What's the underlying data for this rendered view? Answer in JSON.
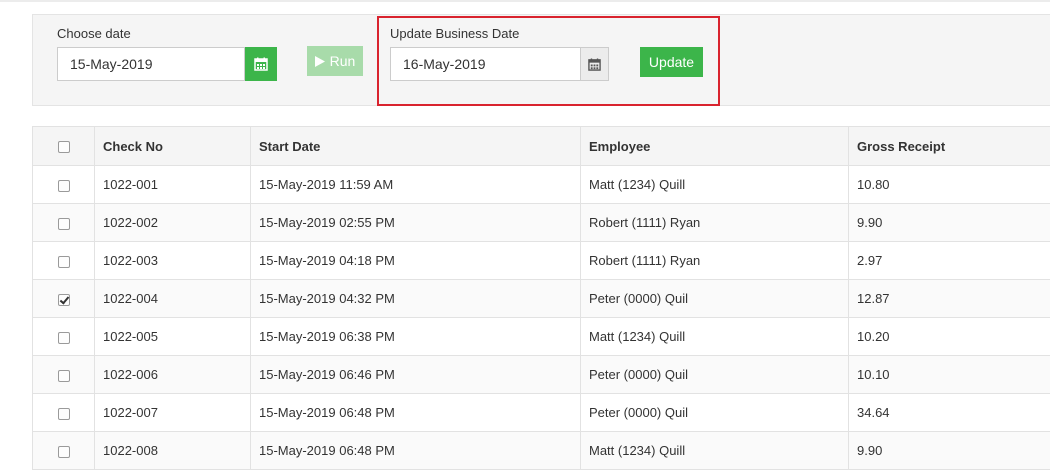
{
  "filter": {
    "choose_date_label": "Choose date",
    "choose_date_value": "15-May-2019",
    "run_label": "Run",
    "update_business_date_label": "Update Business Date",
    "update_date_value": "16-May-2019",
    "update_label": "Update"
  },
  "table": {
    "columns": [
      "",
      "Check No",
      "Start Date",
      "Employee",
      "Gross Receipt"
    ],
    "rows": [
      {
        "checked": false,
        "check_no": "1022-001",
        "start_date": "15-May-2019 11:59 AM",
        "employee": "Matt (1234) Quill",
        "gross": "10.80"
      },
      {
        "checked": false,
        "check_no": "1022-002",
        "start_date": "15-May-2019 02:55 PM",
        "employee": "Robert (1111) Ryan",
        "gross": "9.90"
      },
      {
        "checked": false,
        "check_no": "1022-003",
        "start_date": "15-May-2019 04:18 PM",
        "employee": "Robert (1111) Ryan",
        "gross": "2.97"
      },
      {
        "checked": true,
        "check_no": "1022-004",
        "start_date": "15-May-2019 04:32 PM",
        "employee": "Peter (0000) Quil",
        "gross": "12.87"
      },
      {
        "checked": false,
        "check_no": "1022-005",
        "start_date": "15-May-2019 06:38 PM",
        "employee": "Matt (1234) Quill",
        "gross": "10.20"
      },
      {
        "checked": false,
        "check_no": "1022-006",
        "start_date": "15-May-2019 06:46 PM",
        "employee": "Peter (0000) Quil",
        "gross": "10.10"
      },
      {
        "checked": false,
        "check_no": "1022-007",
        "start_date": "15-May-2019 06:48 PM",
        "employee": "Peter (0000) Quil",
        "gross": "34.64"
      },
      {
        "checked": false,
        "check_no": "1022-008",
        "start_date": "15-May-2019 06:48 PM",
        "employee": "Matt (1234) Quill",
        "gross": "9.90"
      }
    ]
  },
  "icons": {
    "calendar": "calendar-icon",
    "play": "play-icon"
  },
  "colors": {
    "accent_green": "#3cb54a",
    "run_disabled_green": "#a8dbaa",
    "highlight_red": "#d9232e"
  }
}
